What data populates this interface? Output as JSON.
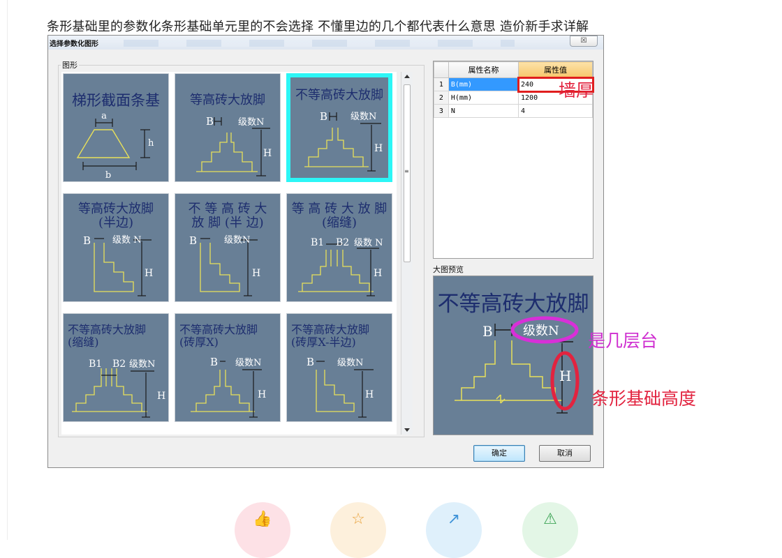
{
  "post": {
    "title": "条形基础里的参数化条形基础单元里的不会选择   不懂里边的几个都代表什么意思    造价新手求详解"
  },
  "dialog": {
    "title": "选择参数化图形",
    "close_label": "☒",
    "group_label": "图形",
    "preview_label": "大图预览",
    "ok_label": "确定",
    "cancel_label": "取消"
  },
  "tiles": [
    {
      "caption": "梯形截面条基",
      "labels": [
        "a",
        "h",
        "b"
      ],
      "selected": false
    },
    {
      "caption": "等高砖大放脚",
      "labels": [
        "B",
        "级数N",
        "H"
      ],
      "selected": false
    },
    {
      "caption": "不等高砖大放脚",
      "labels": [
        "B",
        "级数N",
        "H"
      ],
      "selected": true
    },
    {
      "caption": "等高砖大放脚\n(半边)",
      "labels": [
        "B",
        "级数 N",
        "H"
      ],
      "selected": false
    },
    {
      "caption": "不 等 高 砖 大\n放 脚 (半 边)",
      "labels": [
        "B",
        "级数N",
        "H"
      ],
      "selected": false
    },
    {
      "caption": "等 高 砖 大 放 脚\n(缩缝)",
      "labels": [
        "B1",
        "B2",
        "级数 N",
        "H"
      ],
      "selected": false
    },
    {
      "caption": "不等高砖大放脚\n(缩缝)",
      "labels": [
        "B1",
        "B2",
        "级数N",
        "H"
      ],
      "selected": false
    },
    {
      "caption": "不等高砖大放脚\n(砖厚X)",
      "labels": [
        "B",
        "级数N",
        "H"
      ],
      "selected": false
    },
    {
      "caption": "不等高砖大放脚\n(砖厚X-半边)",
      "labels": [
        "B",
        "级数N",
        "H"
      ],
      "selected": false
    }
  ],
  "properties": {
    "header_name": "属性名称",
    "header_value": "属性值",
    "rows": [
      {
        "idx": "1",
        "name": "B(mm)",
        "value": "240"
      },
      {
        "idx": "2",
        "name": "H(mm)",
        "value": "1200"
      },
      {
        "idx": "3",
        "name": "N",
        "value": "4"
      }
    ]
  },
  "preview": {
    "caption": "不等高砖大放脚",
    "label_b": "B",
    "label_n": "级数N",
    "label_h": "H"
  },
  "annotations": {
    "wall_thickness": "墙厚",
    "level_count": "是几层台",
    "foundation_height": "条形基础高度"
  },
  "colors": {
    "tile_bg": "#687f96",
    "tile_text": "#1d2d6e",
    "drawing": "#e8e05a",
    "selection": "#2cf6f6",
    "annotation_red": "#e2233f",
    "annotation_magenta": "#cf2fd0"
  },
  "actions": [
    "thumbs-up-icon",
    "star-icon",
    "share-icon",
    "warning-icon"
  ]
}
